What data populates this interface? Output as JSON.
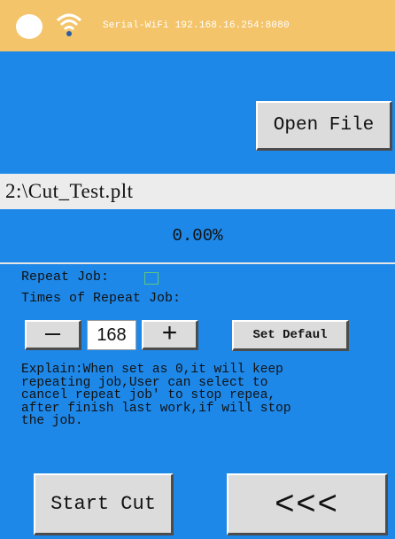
{
  "status_bar": {
    "network_text": "Serial-WiFi 192.168.16.254:8080",
    "colors": {
      "background": "#f4c46a",
      "indicator": "#ffffff"
    },
    "icons": [
      "status-indicator-icon",
      "wifi-icon"
    ]
  },
  "file": {
    "open_button_label": "Open File",
    "path": "2:\\Cut_Test.plt"
  },
  "progress": {
    "text": "0.00%",
    "value": 0
  },
  "repeat": {
    "repeat_job_label": "Repeat Job:",
    "repeat_job_checked": false,
    "times_label": "Times of Repeat Job:",
    "times_value": "168",
    "minus_label": "—",
    "plus_label": "+",
    "set_default_label": "Set Defaul"
  },
  "explain_text": "Explain:When set as 0,it will keep\nrepeating job,User can select to\ncancel repeat job' to stop repea,\nafter finish last work,if will stop\nthe job.",
  "actions": {
    "start_cut_label": "Start Cut",
    "back_label": "<<<"
  },
  "colors": {
    "panel_background": "#1e88e8",
    "button_face": "#dcdcdc",
    "checkbox_border": "#5ec77e"
  }
}
